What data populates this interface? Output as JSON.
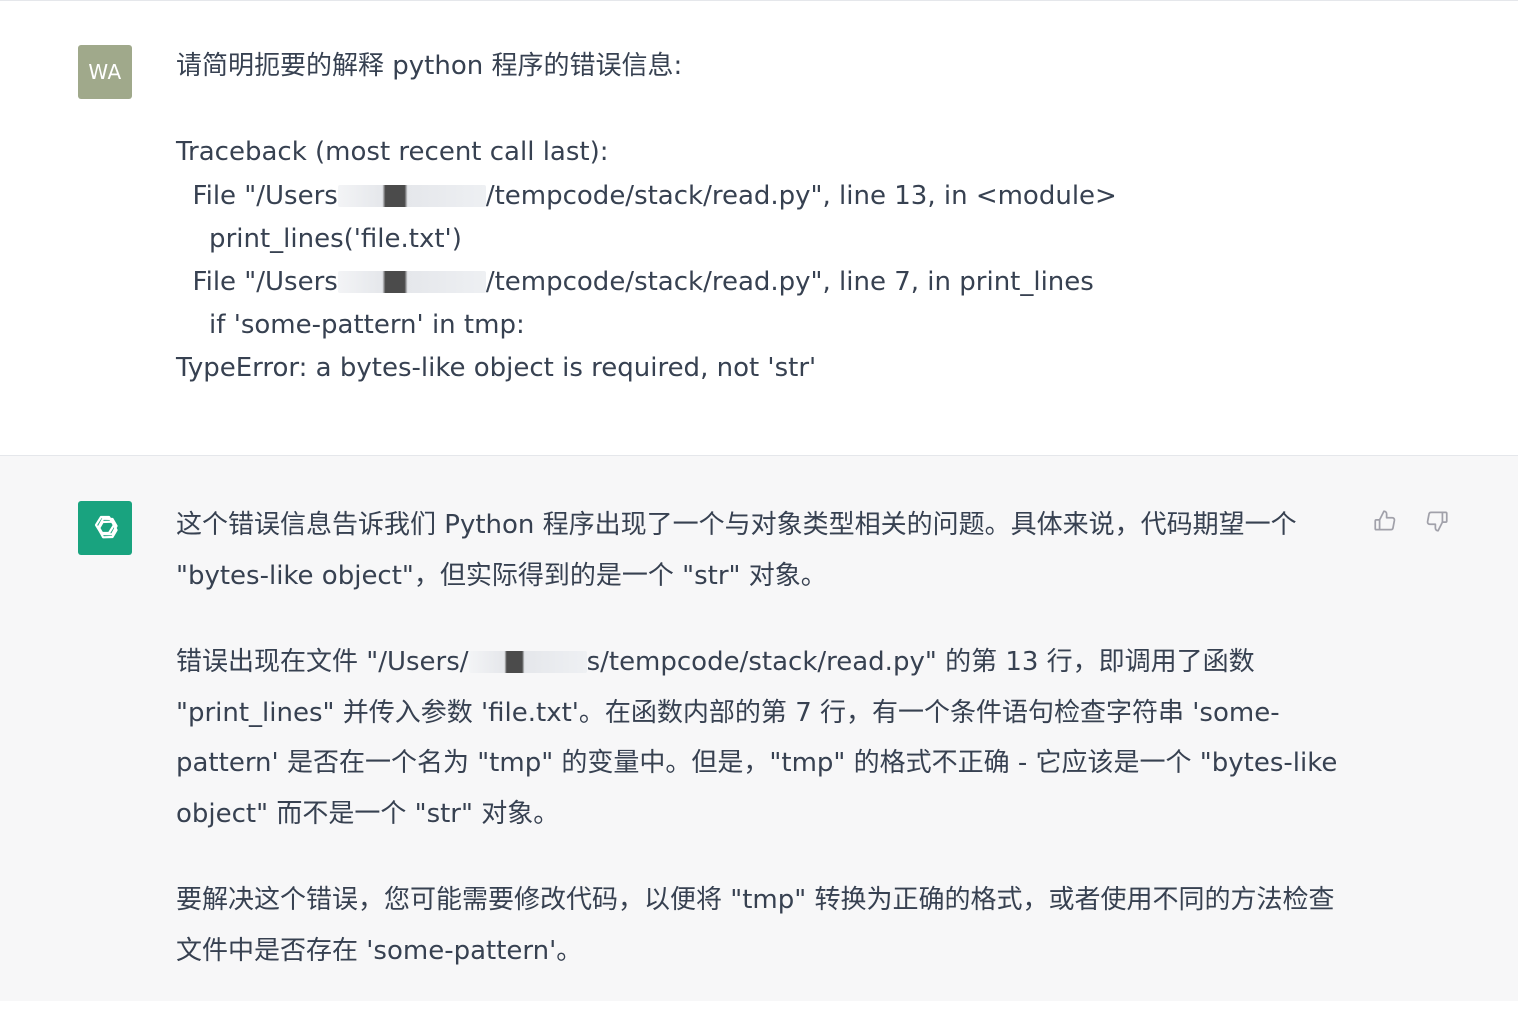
{
  "user": {
    "avatar_initials": "WA",
    "prompt": "请简明扼要的解释 python 程序的错误信息:",
    "traceback": [
      "Traceback (most recent call last):",
      "  File \"/Users",
      "/tempcode/stack/read.py\", line 13, in <module>",
      "    print_lines('file.txt')",
      "  File \"/Users",
      "/tempcode/stack/read.py\", line 7, in print_lines",
      "    if 'some-pattern' in tmp:",
      "TypeError: a bytes-like object is required, not 'str'"
    ]
  },
  "assistant": {
    "avatar_icon": "openai-logo-icon",
    "p1": "这个错误信息告诉我们 Python 程序出现了一个与对象类型相关的问题。具体来说，代码期望一个 \"bytes-like object\"，但实际得到的是一个 \"str\" 对象。",
    "p2_a": "错误出现在文件 \"/Users/",
    "p2_b": "s/tempcode/stack/read.py\" 的第 13 行，即调用了函数 \"print_lines\" 并传入参数 'file.txt'。在函数内部的第 7 行，有一个条件语句检查字符串 'some-pattern' 是否在一个名为 \"tmp\" 的变量中。但是，\"tmp\" 的格式不正确 - 它应该是一个 \"bytes-like object\" 而不是一个 \"str\" 对象。",
    "p3": "要解决这个错误，您可能需要修改代码，以便将 \"tmp\" 转换为正确的格式，或者使用不同的方法检查文件中是否存在 'some-pattern'。"
  },
  "actions": {
    "thumbs_up_icon": "thumbs-up-icon",
    "thumbs_down_icon": "thumbs-down-icon"
  }
}
